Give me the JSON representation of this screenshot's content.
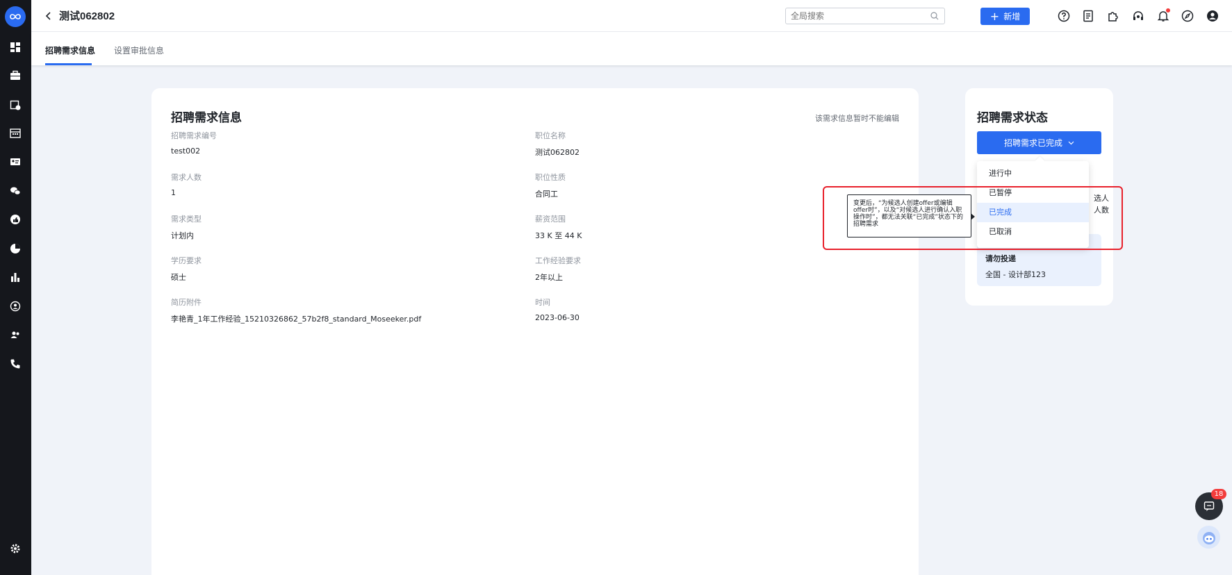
{
  "header": {
    "title": "测试062802",
    "search_placeholder": "全局搜索",
    "new_button": "新增",
    "icons": [
      "help-icon",
      "document-icon",
      "plugin-icon",
      "headset-icon",
      "bell-icon",
      "compass-icon",
      "user-icon"
    ]
  },
  "sidebar": {
    "icons": [
      "dashboard-icon",
      "briefcase-icon",
      "calendar-check-icon",
      "schedule-icon",
      "id-card-icon",
      "wechat-icon",
      "thumbs-up-icon",
      "pie-chart-icon",
      "bar-chart-icon",
      "person-circle-icon",
      "team-icon",
      "phone-icon",
      "settings-icon"
    ]
  },
  "tabs": [
    {
      "label": "招聘需求信息",
      "active": true
    },
    {
      "label": "设置审批信息",
      "active": false
    }
  ],
  "info": {
    "title": "招聘需求信息",
    "note": "该需求信息暂时不能编辑",
    "fields": [
      {
        "label": "招聘需求编号",
        "value": "test002"
      },
      {
        "label": "职位名称",
        "value": "测试062802"
      },
      {
        "label": "需求人数",
        "value": "1"
      },
      {
        "label": "职位性质",
        "value": "合同工"
      },
      {
        "label": "需求类型",
        "value": "计划内"
      },
      {
        "label": "薪资范围",
        "value": "33 K 至 44 K"
      },
      {
        "label": "学历要求",
        "value": "硕士"
      },
      {
        "label": "工作经验要求",
        "value": "2年以上"
      },
      {
        "label": "简历附件",
        "value": "李艳青_1年工作经验_15210326862_57b2f8_standard_Moseeker.pdf"
      },
      {
        "label": "时间",
        "value": "2023-06-30"
      }
    ]
  },
  "status": {
    "title": "招聘需求状态",
    "button": "招聘需求已完成",
    "partial1": "选人",
    "partial2": "人数",
    "info_line1": "请勿投递",
    "info_line2": "全国 - 设计部123",
    "options": [
      "进行中",
      "已暂停",
      "已完成",
      "已取消"
    ],
    "selected": "已完成",
    "tooltip": "变更后，“为候选人创建offer或编辑offer时”，以及“对候选人进行确认入职操作时”，都无法关联“已完成”状态下的招聘需求"
  },
  "chat": {
    "badge": "18"
  },
  "colors": {
    "primary": "#2a6bf0",
    "highlight": "#e8202b",
    "sidebar": "#15171c"
  }
}
